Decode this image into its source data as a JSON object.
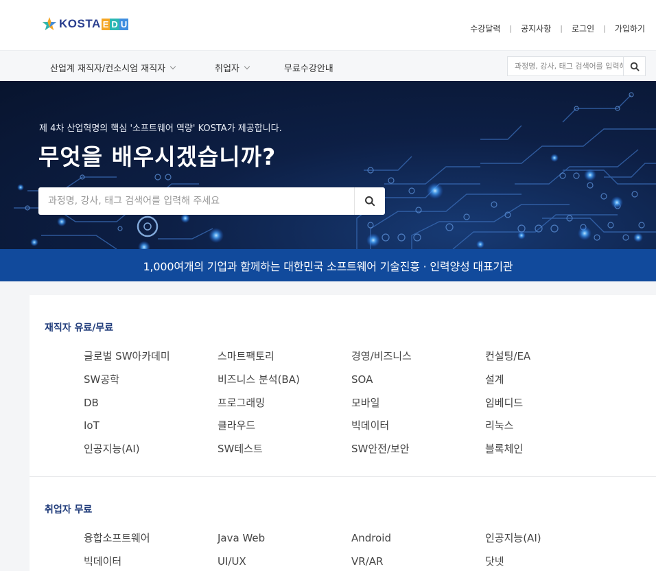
{
  "brand": {
    "logo_text": "KOSTA",
    "logo_edu": [
      "E",
      "D",
      "U"
    ],
    "colors": {
      "navy": "#2a3f8f",
      "e": "#f5a623",
      "d": "#2bb7b3",
      "u": "#3f8ee0",
      "banner": "#114a9c"
    }
  },
  "utility_links": [
    "수강달력",
    "공지사항",
    "로그인",
    "가입하기"
  ],
  "nav": {
    "items": [
      {
        "label": "산업계 재직자/컨소시엄 재직자",
        "dropdown": true
      },
      {
        "label": "취업자",
        "dropdown": true
      },
      {
        "label": "무료수강안내",
        "dropdown": false
      }
    ],
    "search_placeholder": "과정명, 강사, 태그 검색어를 입력해 주세요",
    "search_icon": "search-icon"
  },
  "hero": {
    "subtitle": "제 4차 산업혁명의 핵심 '소프트웨어 역량' KOSTA가 제공합니다.",
    "title": "무엇을 배우시겠습니까?",
    "search_placeholder": "과정명, 강사, 태그 검색어를 입력해 주세요"
  },
  "banner": "1,000여개의 기업과 함께하는 대한민국 소프트웨어 기술진흥 · 인력양성 대표기관",
  "sections": [
    {
      "title": "재직자 유료/무료",
      "items": [
        "글로벌 SW아카데미",
        "스마트팩토리",
        "경영/비즈니스",
        "컨설팅/EA",
        "SW공학",
        "비즈니스 분석(BA)",
        "SOA",
        "설계",
        "DB",
        "프로그래밍",
        "모바일",
        "임베디드",
        "IoT",
        "클라우드",
        "빅데이터",
        "리눅스",
        "인공지능(AI)",
        "SW테스트",
        "SW안전/보안",
        "블록체인"
      ]
    },
    {
      "title": "취업자 무료",
      "items": [
        "융합소프트웨어",
        "Java Web",
        "Android",
        "인공지능(AI)",
        "빅데이터",
        "UI/UX",
        "VR/AR",
        "닷넷"
      ]
    }
  ]
}
